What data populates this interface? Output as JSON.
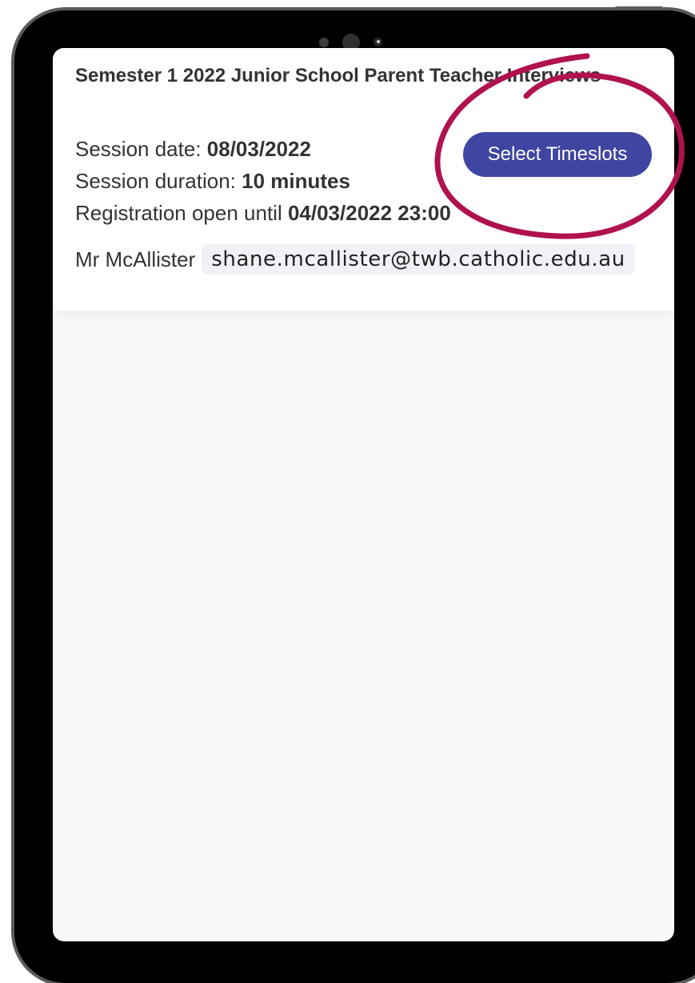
{
  "session": {
    "title": "Semester 1 2022 Junior School Parent Teacher Interviews",
    "date_label": "Session date: ",
    "date_value": "08/03/2022",
    "duration_label": "Session duration: ",
    "duration_value": "10 minutes",
    "registration_label": "Registration open until ",
    "registration_value": "04/03/2022 23:00",
    "select_button_label": "Select Timeslots"
  },
  "teacher": {
    "name": "Mr McAllister",
    "email": "shane.mcallister@twb.catholic.edu.au"
  },
  "colors": {
    "accent": "#3f46a2",
    "annotation": "#b0124f",
    "device_bezel": "#000000",
    "screen_background": "#f8f8f8"
  },
  "icons": {
    "front_camera": "camera-icon",
    "annotation_mark": "highlight-circle-icon"
  }
}
